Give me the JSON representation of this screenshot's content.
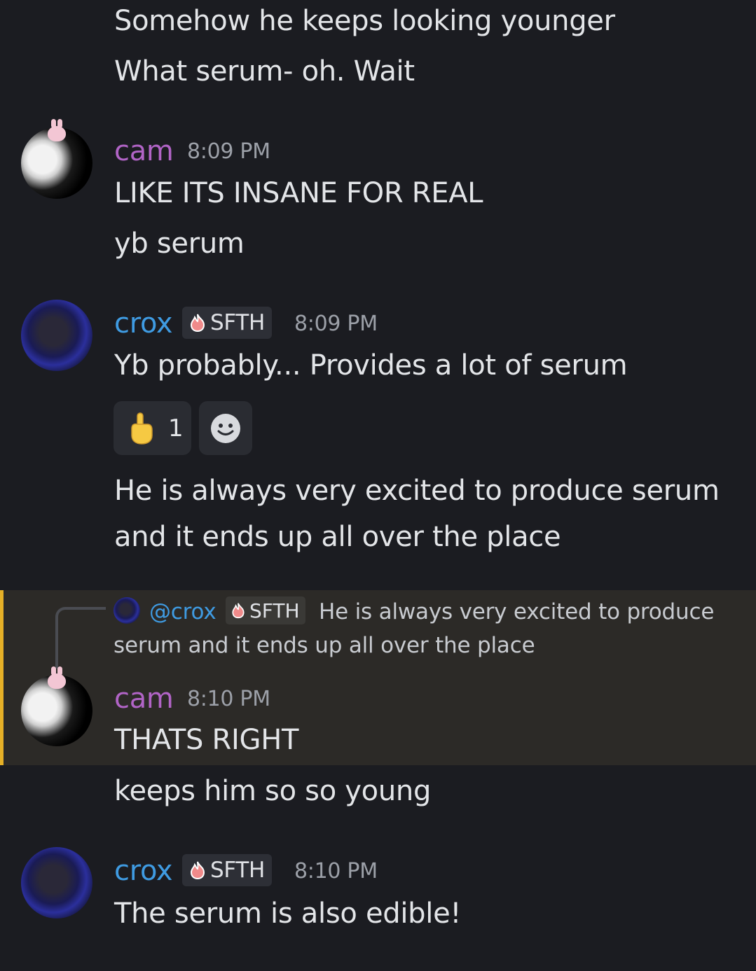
{
  "messages_top": {
    "line1": "Somehow he keeps looking younger",
    "line2": "What serum- oh. Wait"
  },
  "group_cam_1": {
    "username": "cam",
    "time": "8:09 PM",
    "line1": "LIKE ITS INSANE FOR REAL",
    "line2": "yb serum"
  },
  "group_crox_1": {
    "username": "crox",
    "tag": "SFTH",
    "time": "8:09 PM",
    "line1": "Yb probably... Provides a lot of serum",
    "reaction_count": "1",
    "line2a": "He is always very excited to produce serum",
    "line2b": "and it ends up all over the place"
  },
  "reply": {
    "mention": "@crox",
    "tag": "SFTH",
    "preview_a": "He is always very excited to produce",
    "preview_b": "serum and it ends up all over the place"
  },
  "group_cam_2": {
    "username": "cam",
    "time": "8:10 PM",
    "line1": "THATS RIGHT",
    "line2": "keeps him so so young"
  },
  "group_crox_2": {
    "username": "crox",
    "tag": "SFTH",
    "time": "8:10 PM",
    "line1": "The serum is also edible!"
  },
  "colors": {
    "background": "#1b1c21",
    "cam_name": "#b164c6",
    "crox_name": "#3f9be2",
    "mention": "#3f9be2",
    "reply_highlight": "#2c2a27",
    "reply_bar": "#e5b027"
  },
  "icons": [
    "pointing-up-emoji-icon",
    "add-reaction-icon",
    "fire-tag-icon"
  ]
}
